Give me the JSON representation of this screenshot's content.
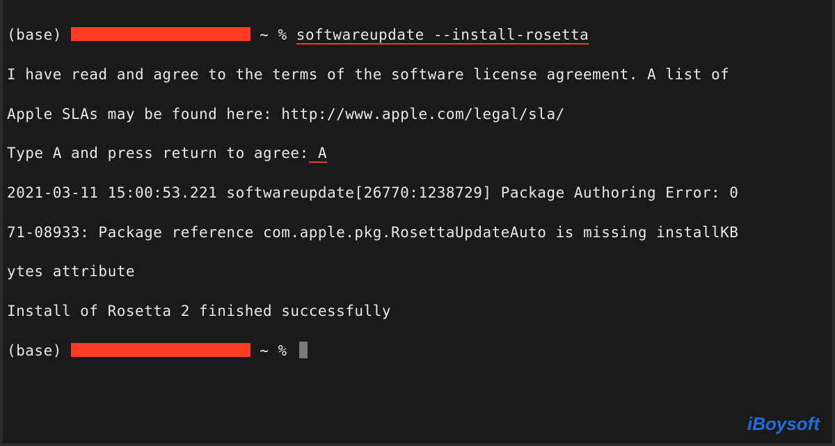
{
  "terminal": {
    "prompt1_prefix": "(base) ",
    "prompt1_suffix": " ~ % ",
    "command": "softwareupdate --install-rosetta",
    "output_license1": "I have read and agree to the terms of the software license agreement. A list of",
    "output_license2": "Apple SLAs may be found here: http://www.apple.com/legal/sla/",
    "agree_prompt": "Type A and press return to agree:",
    "agree_input": " A",
    "error_line1": "2021-03-11 15:00:53.221 softwareupdate[26770:1238729] Package Authoring Error: 0",
    "error_line2": "71-08933: Package reference com.apple.pkg.RosettaUpdateAuto is missing installKB",
    "error_line3": "ytes attribute",
    "success_line": "Install of Rosetta 2 finished successfully",
    "prompt2_prefix": "(base) ",
    "prompt2_suffix": " ~ % "
  },
  "watermark": "iBoysoft"
}
